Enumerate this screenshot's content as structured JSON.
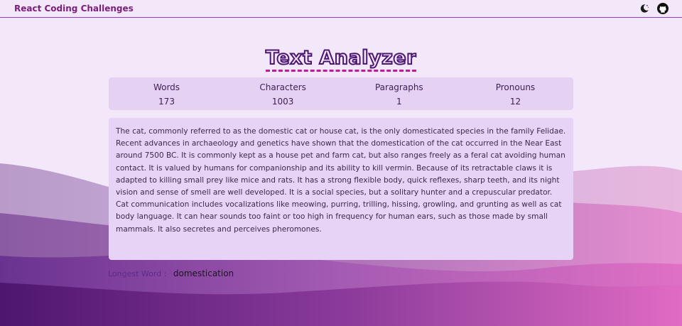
{
  "header": {
    "brand": "React Coding Challenges",
    "theme_icon": "moon-icon",
    "repo_icon": "github-icon"
  },
  "page": {
    "title": "Text Analyzer"
  },
  "stats": [
    {
      "label": "Words",
      "value": "173"
    },
    {
      "label": "Characters",
      "value": "1003"
    },
    {
      "label": "Paragraphs",
      "value": "1"
    },
    {
      "label": "Pronouns",
      "value": "12"
    }
  ],
  "editor": {
    "text": "The cat, commonly referred to as the domestic cat or house cat, is the only domesticated species in the family Felidae. Recent advances in archaeology and genetics have shown that the domestication of the cat occurred in the Near East around 7500 BC. It is commonly kept as a house pet and farm cat, but also ranges freely as a feral cat avoiding human contact. It is valued by humans for companionship and its ability to kill vermin. Because of its retractable claws it is adapted to killing small prey like mice and rats. It has a strong flexible body, quick reflexes, sharp teeth, and its night vision and sense of smell are well developed. It is a social species, but a solitary hunter and a crepuscular predator. Cat communication includes vocalizations like meowing, purring, trilling, hissing, growling, and grunting as well as cat body language. It can hear sounds too faint or too high in frequency for human ears, such as those made by small mammals. It also secretes and perceives pheromones."
  },
  "longest_word": {
    "label": "Longest Word :",
    "value": "domestication"
  },
  "colors": {
    "accent": "#7a1f7a",
    "panel": "#e5d2f3",
    "background": "#f3e8f9",
    "wave_dark": "#5a1a78",
    "wave_pink": "#e06bc4"
  }
}
